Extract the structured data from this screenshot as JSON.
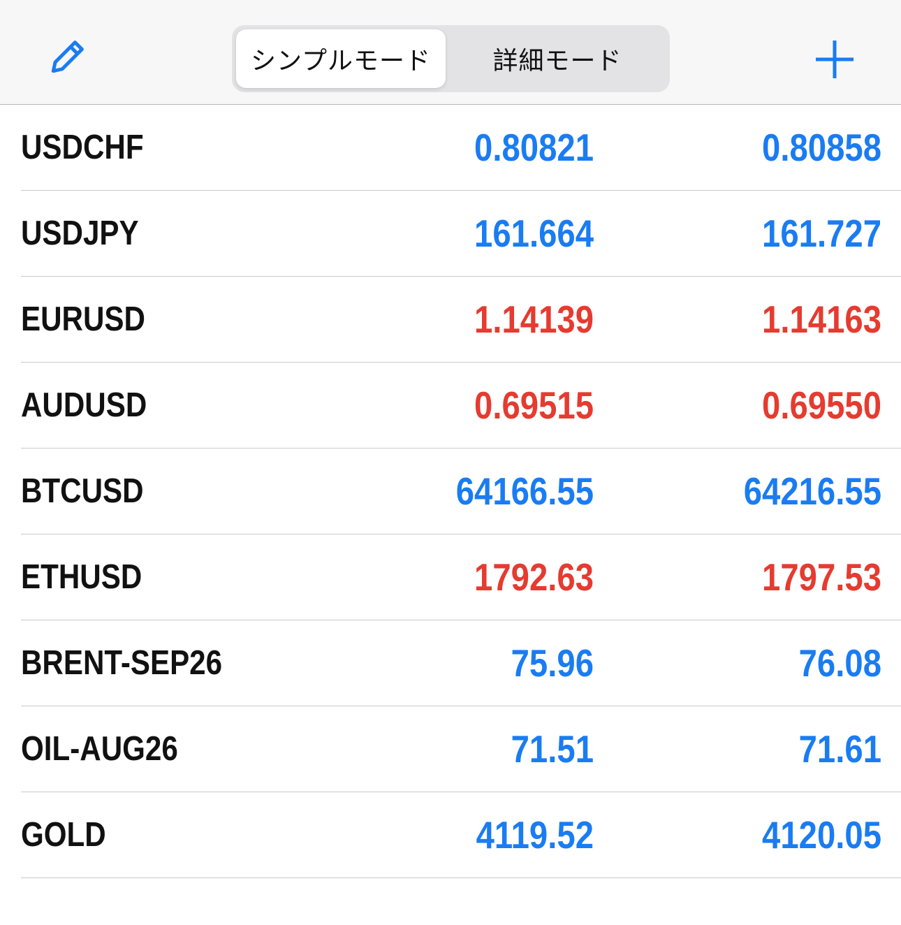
{
  "colors": {
    "up": "#1a7cf2",
    "down": "#e53b30",
    "accent": "#1a7cf2"
  },
  "header": {
    "edit_icon": "pencil-icon",
    "add_icon": "plus-icon",
    "segments": [
      {
        "label": "シンプルモード",
        "selected": true
      },
      {
        "label": "詳細モード",
        "selected": false
      }
    ]
  },
  "quotes": [
    {
      "symbol": "USDCHF",
      "bid": "0.80821",
      "ask": "0.80858",
      "direction": "up"
    },
    {
      "symbol": "USDJPY",
      "bid": "161.664",
      "ask": "161.727",
      "direction": "up"
    },
    {
      "symbol": "EURUSD",
      "bid": "1.14139",
      "ask": "1.14163",
      "direction": "down"
    },
    {
      "symbol": "AUDUSD",
      "bid": "0.69515",
      "ask": "0.69550",
      "direction": "down"
    },
    {
      "symbol": "BTCUSD",
      "bid": "64166.55",
      "ask": "64216.55",
      "direction": "up"
    },
    {
      "symbol": "ETHUSD",
      "bid": "1792.63",
      "ask": "1797.53",
      "direction": "down"
    },
    {
      "symbol": "BRENT-SEP26",
      "bid": "75.96",
      "ask": "76.08",
      "direction": "up"
    },
    {
      "symbol": "OIL-AUG26",
      "bid": "71.51",
      "ask": "71.61",
      "direction": "up"
    },
    {
      "symbol": "GOLD",
      "bid": "4119.52",
      "ask": "4120.05",
      "direction": "up"
    }
  ]
}
